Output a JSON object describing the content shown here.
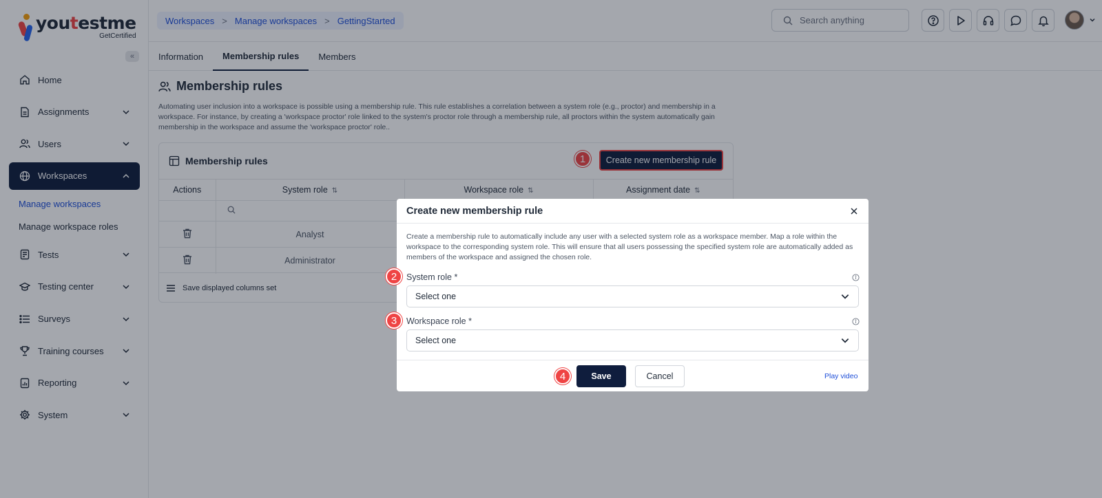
{
  "brand": {
    "logo_word_pre": "you",
    "logo_word_accent": "t",
    "logo_word_post": "estme",
    "logo_sub": "GetCertified",
    "primary_color": "#0f1d3d",
    "accent_color": "#ef4444",
    "link_color": "#1d4ed8"
  },
  "sidebar": {
    "collapse_label": "«",
    "items": [
      {
        "label": "Home",
        "icon": "home-icon"
      },
      {
        "label": "Assignments",
        "icon": "document-icon"
      },
      {
        "label": "Users",
        "icon": "users-icon"
      },
      {
        "label": "Workspaces",
        "icon": "globe-icon"
      },
      {
        "label": "Tests",
        "icon": "test-icon"
      },
      {
        "label": "Testing center",
        "icon": "testing-center-icon"
      },
      {
        "label": "Surveys",
        "icon": "list-icon"
      },
      {
        "label": "Training courses",
        "icon": "trophy-icon"
      },
      {
        "label": "Reporting",
        "icon": "report-icon"
      },
      {
        "label": "System",
        "icon": "gear-icon"
      }
    ],
    "workspaces_sub": [
      {
        "label": "Manage workspaces"
      },
      {
        "label": "Manage workspace roles"
      }
    ]
  },
  "breadcrumb": {
    "items": [
      "Workspaces",
      "Manage workspaces",
      "GettingStarted"
    ],
    "separator": ">"
  },
  "search": {
    "placeholder": "Search anything"
  },
  "tabs": [
    {
      "label": "Information"
    },
    {
      "label": "Membership rules"
    },
    {
      "label": "Members"
    }
  ],
  "page": {
    "title": "Membership rules",
    "description": "Automating user inclusion into a workspace is possible using a membership rule. This rule establishes a correlation between a system role (e.g., proctor) and membership in a workspace. For instance, by creating a 'workspace proctor' role linked to the system's proctor role through a membership rule, all proctors within the system automatically gain membership in the workspace and assume the 'workspace proctor' role.."
  },
  "card": {
    "title": "Membership rules",
    "create_button": "Create new membership rule",
    "columns": [
      "Actions",
      "System role",
      "Workspace role",
      "Assignment date"
    ],
    "sort_glyph": "⇅",
    "rows": [
      {
        "system_role": "Analyst"
      },
      {
        "system_role": "Administrator"
      }
    ],
    "footer": "Save displayed columns set"
  },
  "modal": {
    "title": "Create new membership rule",
    "description": "Create a membership rule to automatically include any user with a selected system role as a workspace member. Map a role within the workspace to the corresponding system role. This will ensure that all users possessing the specified system role are automatically added as members of the workspace and assigned the chosen role.",
    "system_role_label": "System role *",
    "system_role_value": "Select one",
    "workspace_role_label": "Workspace role *",
    "workspace_role_value": "Select one",
    "save_label": "Save",
    "cancel_label": "Cancel",
    "play_video_label": "Play video"
  },
  "step_badges": [
    "1",
    "2",
    "3",
    "4"
  ]
}
